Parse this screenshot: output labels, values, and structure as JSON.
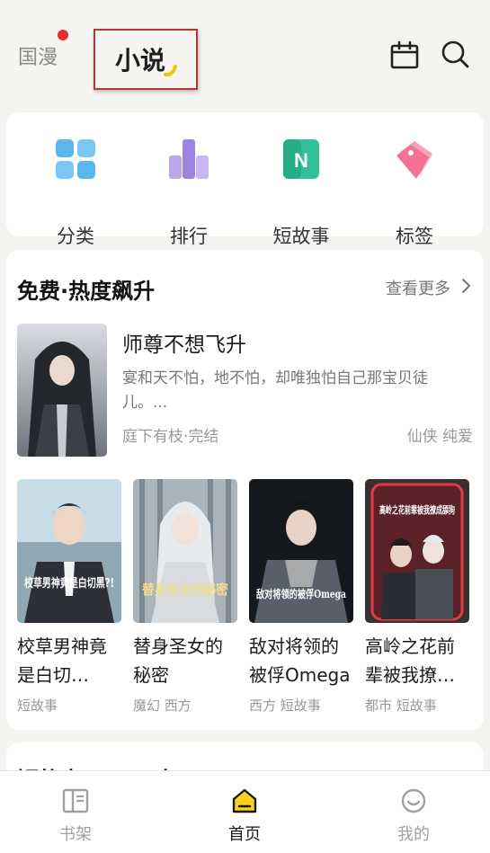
{
  "header": {
    "tabs": [
      {
        "label": "国漫",
        "has_dot": true
      },
      {
        "label": "小说",
        "selected": true
      }
    ],
    "icons": [
      "calendar-icon",
      "search-icon"
    ],
    "dot_color": "#ee2b2b",
    "accent_color": "#f4c20d"
  },
  "categories": [
    {
      "label": "分类",
      "icon": "grid-icon"
    },
    {
      "label": "排行",
      "icon": "ranking-icon"
    },
    {
      "label": "短故事",
      "icon": "short-story-icon"
    },
    {
      "label": "标签",
      "icon": "tag-icon"
    }
  ],
  "free_section": {
    "title": "免费·热度飙升",
    "more_label": "查看更多",
    "featured": {
      "title": "师尊不想飞升",
      "description": "宴和天不怕，地不怕，却唯独怕自己那宝贝徒儿。...",
      "author_status": "庭下有枝·完结",
      "tags": "仙侠 纯爱"
    },
    "books": [
      {
        "title": "校草男神竟是白切…",
        "tags": "短故事",
        "cover_text": "校草男神竟是白切黑?!"
      },
      {
        "title": "替身圣女的秘密",
        "tags": "魔幻 西方",
        "cover_text": "替身圣女的秘密"
      },
      {
        "title": "敌对将领的被俘Omega",
        "tags": "西方 短故事",
        "cover_text": "敌对将领的被俘Omega"
      },
      {
        "title": "高岭之花前辈被我撩…",
        "tags": "都市 短故事",
        "cover_text": "高岭之花前辈被我撩成舔狗"
      }
    ]
  },
  "next_section": {
    "title": "短故事·三三三十"
  },
  "bottom_nav": [
    {
      "label": "书架",
      "icon": "bookshelf-icon",
      "active": false
    },
    {
      "label": "首页",
      "icon": "home-icon",
      "active": true
    },
    {
      "label": "我的",
      "icon": "profile-icon",
      "active": false
    }
  ]
}
